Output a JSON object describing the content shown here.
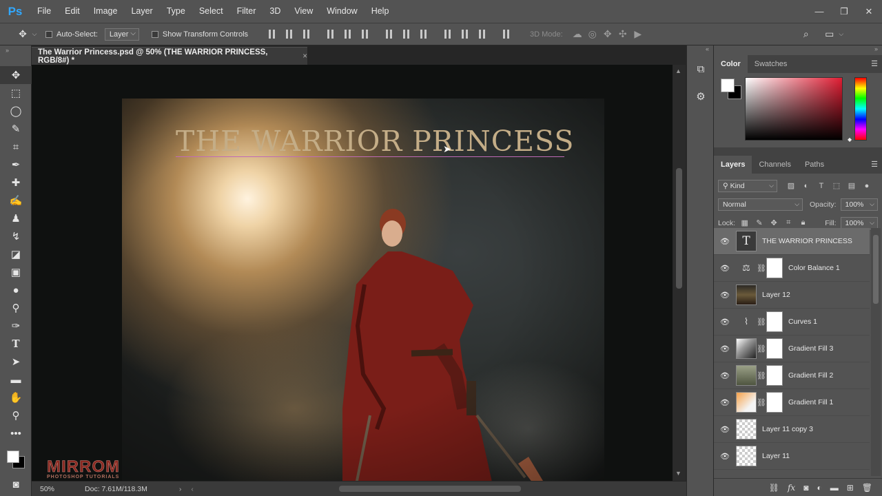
{
  "app": {
    "logo": "Ps"
  },
  "menu": [
    "File",
    "Edit",
    "Image",
    "Layer",
    "Type",
    "Select",
    "Filter",
    "3D",
    "View",
    "Window",
    "Help"
  ],
  "window_controls": {
    "minimize": "—",
    "maximize": "❐",
    "close": "✕"
  },
  "options_bar": {
    "auto_select_label": "Auto-Select:",
    "auto_select_checked": false,
    "target_dropdown": "Layer",
    "show_transform_label": "Show Transform Controls",
    "show_transform_checked": false,
    "mode_3d_label": "3D Mode:"
  },
  "document": {
    "tab_title": "The Warrior Princess.psd @ 50% (THE WARRIOR PRINCESS, RGB/8#) *",
    "tab_close": "×",
    "canvas_title_text": "THE WARRIOR PRINCESS"
  },
  "watermark": {
    "main": "MIRROM",
    "sub": "PHOTOSHOP TUTORIALS"
  },
  "status_bar": {
    "zoom": "50%",
    "doc_info": "Doc: 7.61M/118.3M",
    "arrow": "›"
  },
  "color_panel": {
    "tabs": [
      "Color",
      "Swatches"
    ],
    "active_tab": "Color",
    "foreground": "#ffffff",
    "background": "#000000",
    "field_hue": "#e01d33"
  },
  "layers_panel": {
    "tabs": [
      "Layers",
      "Channels",
      "Paths"
    ],
    "active_tab": "Layers",
    "filter_kind": "Kind",
    "blend_mode": "Normal",
    "opacity_label": "Opacity:",
    "opacity_value": "100%",
    "lock_label": "Lock:",
    "fill_label": "Fill:",
    "fill_value": "100%",
    "layers": [
      {
        "name": "THE WARRIOR PRINCESS",
        "kind": "text",
        "selected": true,
        "visible": true
      },
      {
        "name": "Color Balance 1",
        "kind": "adjustment-balance",
        "selected": false,
        "visible": true
      },
      {
        "name": "Layer 12",
        "kind": "photo",
        "selected": false,
        "visible": true
      },
      {
        "name": "Curves 1",
        "kind": "adjustment-curves",
        "selected": false,
        "visible": true
      },
      {
        "name": "Gradient Fill 3",
        "kind": "gradient",
        "selected": false,
        "visible": true
      },
      {
        "name": "Gradient Fill 2",
        "kind": "gradient",
        "selected": false,
        "visible": true
      },
      {
        "name": "Gradient Fill 1",
        "kind": "gradient",
        "selected": false,
        "visible": true
      },
      {
        "name": "Layer 11 copy 3",
        "kind": "empty",
        "selected": false,
        "visible": true
      },
      {
        "name": "Layer 11",
        "kind": "empty",
        "selected": false,
        "visible": true
      }
    ]
  }
}
